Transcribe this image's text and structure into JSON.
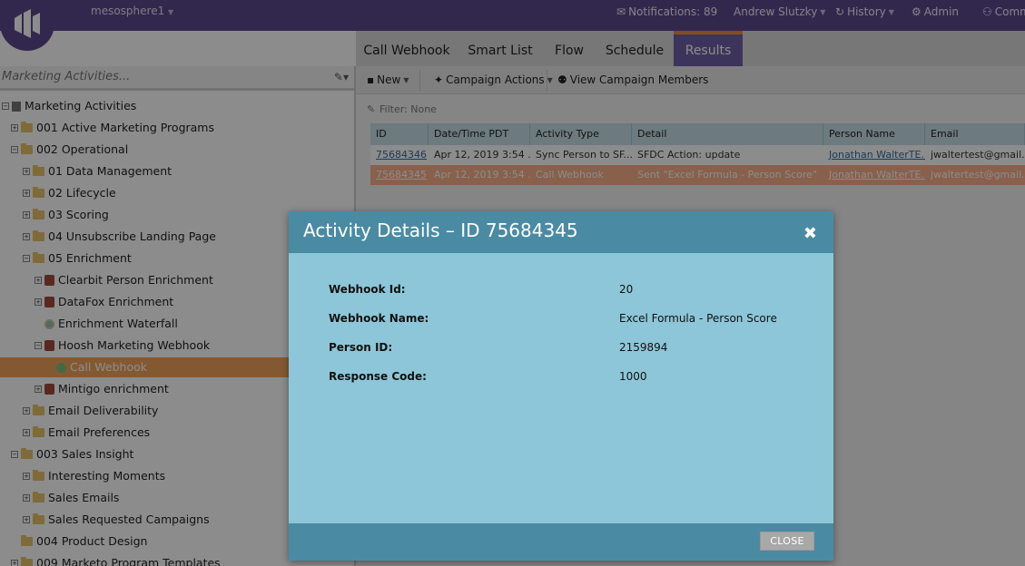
{
  "topbar": {
    "workspace": "mesosphere1",
    "notifications": "Notifications: 89",
    "user": "Andrew Slutzky",
    "history": "History",
    "admin": "Admin",
    "community": "Comm"
  },
  "tabs": [
    "Call Webhook",
    "Smart List",
    "Flow",
    "Schedule",
    "Results"
  ],
  "sidebar": {
    "search_placeholder": "Marketing Activities...",
    "tree": [
      "Marketing Activities",
      "001 Active Marketing Programs",
      "002 Operational",
      "01 Data Management",
      "02 Lifecycle",
      "03 Scoring",
      "04 Unsubscribe Landing Page",
      "05 Enrichment",
      "Clearbit Person Enrichment",
      "DataFox Enrichment",
      "Enrichment Waterfall",
      "Hoosh Marketing Webhook",
      "Call Webhook",
      "Mintigo enrichment",
      "Email Deliverability",
      "Email Preferences",
      "003 Sales Insight",
      "Interesting Moments",
      "Sales Emails",
      "Sales Requested Campaigns",
      "004 Product Design",
      "009 Marketo Program Templates"
    ]
  },
  "toolbar": {
    "new": "New",
    "campaign_actions": "Campaign Actions",
    "view_members": "View Campaign Members"
  },
  "filter": "Filter: None",
  "grid": {
    "headers": [
      "ID",
      "Date/Time PDT",
      "Activity Type",
      "Detail",
      "Person Name",
      "Email"
    ],
    "rows": [
      [
        "75684346",
        "Apr 12, 2019 3:54 ...",
        "Sync Person to SF...",
        "SFDC Action: update",
        "Jonathan WalterTE...",
        "jwaltertest@gmail...."
      ],
      [
        "75684345",
        "Apr 12, 2019 3:54 ...",
        "Call Webhook",
        "Sent \"Excel Formula - Person Score\"",
        "Jonathan WalterTE...",
        "jwaltertest@gmail...."
      ]
    ]
  },
  "modal": {
    "title": "Activity Details – ID 75684345",
    "fields": [
      {
        "label": "Webhook Id:",
        "value": "20"
      },
      {
        "label": "Webhook Name:",
        "value": "Excel Formula - Person Score"
      },
      {
        "label": "Person ID:",
        "value": "2159894"
      },
      {
        "label": "Response Code:",
        "value": "1000"
      }
    ],
    "close_label": "CLOSE"
  },
  "colors": {
    "topbar": "#5c4a8f",
    "selected": "#f0a35c",
    "modal_header": "#4a8ba3",
    "modal_body": "#8cc6d8"
  }
}
